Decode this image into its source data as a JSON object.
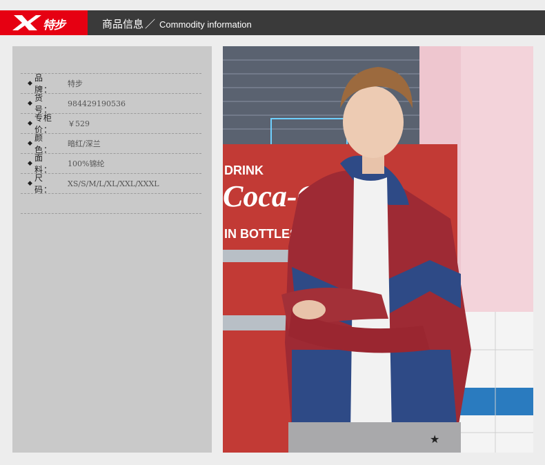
{
  "header": {
    "brand_text": "特步",
    "title_cn": "商品信息",
    "slash": "／",
    "title_en": "Commodity information"
  },
  "specs": [
    {
      "label": "品　牌：",
      "value": "特步"
    },
    {
      "label": "货　号：",
      "value": "984429190536"
    },
    {
      "label": "专柜价：",
      "value": "￥529"
    },
    {
      "label": "颜　色：",
      "value": "暗红/深兰"
    },
    {
      "label": "面　料：",
      "value": "100%锦纶"
    },
    {
      "label": "尺　码：",
      "value": "XS/S/M/L/XL/XXL/XXXL"
    }
  ],
  "bullet_char": "◆",
  "photo": {
    "sign_line1": "DRINK",
    "sign_line2": "Coca-Cola",
    "sign_line3": "IN BOTTLES",
    "colors": {
      "jacket_red": "#9e2a34",
      "jacket_blue": "#2e4a86",
      "wall_pink": "#eec6cf",
      "tile_blue": "#2a7bbf"
    }
  },
  "colors": {
    "brand_red": "#e60012",
    "bar": "#3a3a3a",
    "panel": "#c9c9c9"
  }
}
